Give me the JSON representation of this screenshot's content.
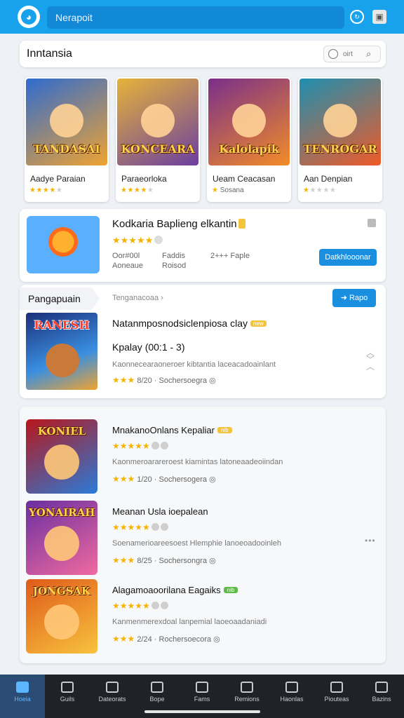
{
  "topbar": {
    "search_text": "Nerapoit",
    "refresh_icon": "refresh-icon",
    "profile_icon": "profile-icon"
  },
  "section": {
    "title": "Inntansia",
    "filter_label": "oirt"
  },
  "featured": [
    {
      "art_title": "TANDASAI",
      "name": "Aadye Paraian",
      "rating": 4,
      "colors": [
        "#2e6bd0",
        "#f0a331"
      ]
    },
    {
      "art_title": "KONCEARA",
      "name": "Paraeorloka",
      "rating": 4,
      "colors": [
        "#e6b33a",
        "#6b3fa0"
      ]
    },
    {
      "art_title": "Kalolapik",
      "name": "Ueam Ceacasan",
      "sub": "Sosana",
      "colors": [
        "#7a2f8a",
        "#f28c28"
      ]
    },
    {
      "art_title": "TENROGAR",
      "name": "Aan Denpian",
      "rating": 1,
      "colors": [
        "#1d8fb0",
        "#f05a28"
      ]
    }
  ],
  "promo": {
    "title": "Kodkaria Baplieng elkantin",
    "rating": 5,
    "meta_col1": [
      "Oor#00l",
      "Aoneaue"
    ],
    "meta_col2": [
      "Faddis",
      "Roisod"
    ],
    "meta_col3": "2+++ Faple",
    "button": "Datkhlooonar"
  },
  "section2": {
    "tab_label": "Pangapuain",
    "crumb": "Tenganacoaa ›",
    "button": "Rapo",
    "art_title": "RANESH",
    "title": "Natanmposnodsiclenpiosa clay",
    "badge": "new",
    "subtitle": "Kpalay (00:1 - 3)",
    "desc": "Kaonnecearaoneroer kibtantia laceacadoainlant",
    "rate": "8/20 · Sochersoegra ◎"
  },
  "list": [
    {
      "art_title": "KONIEL",
      "title": "MnakanoOnlans Kepaliar",
      "badge": "nib",
      "badge_color": "#f2c53d",
      "rating": 5,
      "desc": "Kaonmeroarareroest kiamintas latoneaadeoiindan",
      "rate": "1/20 · Sochersogera ◎",
      "colors": [
        "#b8161a",
        "#2a7bd8"
      ]
    },
    {
      "art_title": "YONAIRAH",
      "title": "Meanan Usla ioepalean",
      "badge": "",
      "badge_color": "",
      "rating": 5,
      "desc": "Soenamerioareesoest Hlemphie lanoeoadooinleh",
      "rate": "8/25 · Sochersongra ◎",
      "colors": [
        "#6a2fa0",
        "#f06aa0"
      ]
    },
    {
      "art_title": "JONGSAK",
      "title": "Alagamoaoorilana Eagaiks",
      "badge": "nib",
      "badge_color": "#5dbb47",
      "rating": 5,
      "desc": "Kanmenmerexdoal lanpemial laoeoaadaniadi",
      "rate": "2/24 · Rochersoecora ◎",
      "colors": [
        "#e05a1a",
        "#f7c33d"
      ]
    }
  ],
  "bottomnav": [
    {
      "label": "Hoeia",
      "icon": "home-icon",
      "active": true
    },
    {
      "label": "Guils",
      "icon": "search-icon",
      "active": false
    },
    {
      "label": "Dateorats",
      "icon": "news-icon",
      "active": false
    },
    {
      "label": "Bope",
      "icon": "window-icon",
      "active": false
    },
    {
      "label": "Fams",
      "icon": "store-icon",
      "active": false
    },
    {
      "label": "Remions",
      "icon": "record-icon",
      "active": false
    },
    {
      "label": "Haonlas",
      "icon": "chat-icon",
      "active": false
    },
    {
      "label": "Piouteas",
      "icon": "building-icon",
      "active": false
    },
    {
      "label": "Bazins",
      "icon": "user-icon",
      "active": false
    }
  ]
}
